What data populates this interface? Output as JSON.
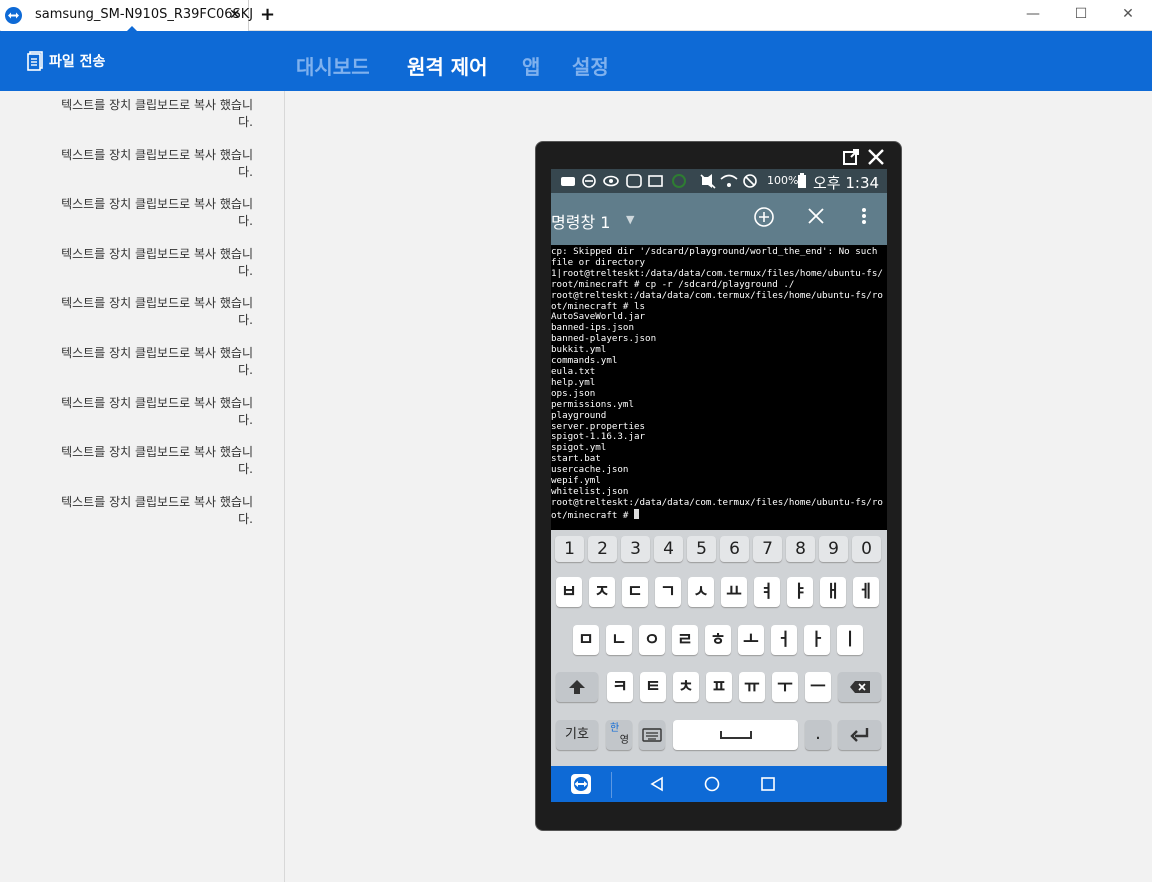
{
  "window": {
    "tab_title": "samsung_SM-N910S_R39FC06SKJ",
    "tab_close": "✕",
    "new_tab": "+",
    "minimize": "—",
    "maximize": "☐",
    "close": "✕"
  },
  "header": {
    "file_transfer": "파일 전송",
    "nav": [
      "대시보드",
      "원격 제어",
      "앱",
      "설정"
    ],
    "active_nav": "원격 제어",
    "accent": "#0e6ad6"
  },
  "sidebar": {
    "messages": [
      "텍스트를 장치 클립보드로 복사 했습니다.",
      "텍스트를 장치 클립보드로 복사 했습니다.",
      "텍스트를 장치 클립보드로 복사 했습니다.",
      "텍스트를 장치 클립보드로 복사 했습니다.",
      "텍스트를 장치 클립보드로 복사 했습니다.",
      "텍스트를 장치 클립보드로 복사 했습니다.",
      "텍스트를 장치 클립보드로 복사 했습니다.",
      "텍스트를 장치 클립보드로 복사 했습니다.",
      "텍스트를 장치 클립보드로 복사 했습니다."
    ]
  },
  "phone": {
    "status": {
      "battery": "100%",
      "time": "오후 1:34"
    },
    "appbar": {
      "title": "명령창 1"
    },
    "terminal": [
      "cp: Skipped dir '/sdcard/playground/world_the_end': No such",
      "file or directory",
      "1|root@trelteskt:/data/data/com.termux/files/home/ubuntu-fs/",
      "root/minecraft # cp -r /sdcard/playground ./",
      "root@trelteskt:/data/data/com.termux/files/home/ubuntu-fs/ro",
      "ot/minecraft # ls",
      "AutoSaveWorld.jar",
      "banned-ips.json",
      "banned-players.json",
      "bukkit.yml",
      "commands.yml",
      "eula.txt",
      "help.yml",
      "ops.json",
      "permissions.yml",
      "playground",
      "server.properties",
      "spigot-1.16.3.jar",
      "spigot.yml",
      "start.bat",
      "usercache.json",
      "wepif.yml",
      "whitelist.json",
      "root@trelteskt:/data/data/com.termux/files/home/ubuntu-fs/ro",
      "ot/minecraft # "
    ],
    "keyboard": {
      "numbers": [
        "1",
        "2",
        "3",
        "4",
        "5",
        "6",
        "7",
        "8",
        "9",
        "0"
      ],
      "row1": [
        "ㅂ",
        "ㅈ",
        "ㄷ",
        "ㄱ",
        "ㅅ",
        "ㅛ",
        "ㅕ",
        "ㅑ",
        "ㅐ",
        "ㅔ"
      ],
      "row2": [
        "ㅁ",
        "ㄴ",
        "ㅇ",
        "ㄹ",
        "ㅎ",
        "ㅗ",
        "ㅓ",
        "ㅏ",
        "ㅣ"
      ],
      "row3": [
        "ㅋ",
        "ㅌ",
        "ㅊ",
        "ㅍ",
        "ㅠ",
        "ㅜ",
        "ㅡ"
      ],
      "symbol_key": "기호",
      "lang_key_top": "한",
      "lang_key_bottom": "영"
    }
  }
}
